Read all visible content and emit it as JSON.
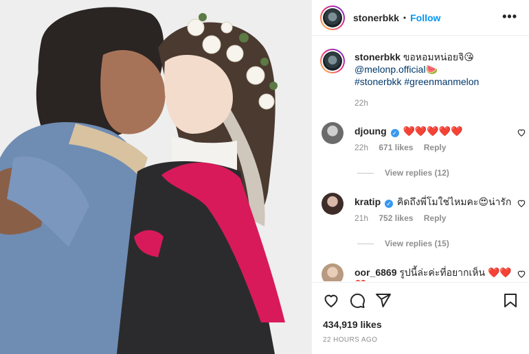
{
  "post": {
    "username": "stonerbkk",
    "separator": "•",
    "follow_label": "Follow",
    "more_label": "•••"
  },
  "caption": {
    "username": "stonerbkk",
    "text_line1": "ขอหอมหน่อยจิ😘",
    "mention": "@melonp.official",
    "mention_emoji": "🍉",
    "hashtag1": "#stonerbkk",
    "hashtag2": "#greenmanmelon",
    "time": "22h"
  },
  "comments": [
    {
      "username": "djoung",
      "text": "❤️❤️❤️❤️❤️",
      "time": "22h",
      "likes": "671 likes",
      "reply_label": "Reply",
      "view_replies": "View replies (12)"
    },
    {
      "username": "kratip",
      "text": "คิดถึงพี่โมใช่ไหมคะ😍น่ารัก",
      "time": "21h",
      "likes": "752 likes",
      "reply_label": "Reply",
      "view_replies": "View replies (15)"
    },
    {
      "username": "oor_6869",
      "text": "รูปนี้ล่ะค่ะที่อยากเห็น ❤️❤️❤️",
      "time": "",
      "likes": "",
      "reply_label": ""
    }
  ],
  "footer": {
    "likes_count": "434,919 likes",
    "posted_time": "22 HOURS AGO"
  },
  "icons": {
    "like": "heart-icon",
    "comment": "comment-icon",
    "share": "share-icon",
    "save": "bookmark-icon"
  },
  "colors": {
    "accent": "#0095f6",
    "link": "#00376b",
    "muted": "#8e8e8e",
    "verified": "#3897f0"
  }
}
